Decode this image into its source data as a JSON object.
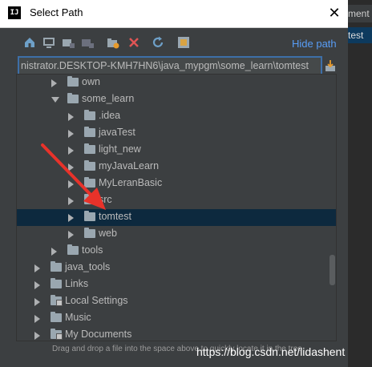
{
  "window": {
    "title": "Select Path",
    "app_icon_text": "IJ",
    "close_glyph": "✕"
  },
  "side_panel": {
    "strip1_text": "ment",
    "strip2_text": "test"
  },
  "toolbar": {
    "icons": [
      "home-icon",
      "desktop-icon",
      "project-icon",
      "module-icon",
      "new-folder-icon",
      "delete-icon",
      "refresh-icon",
      "show-hidden-icon"
    ],
    "hide_path_label": "Hide path"
  },
  "path": {
    "value": "nistrator.DESKTOP-KMH7HN6\\java_mypgm\\some_learn\\tomtest"
  },
  "tree": {
    "rows": [
      {
        "label": "own",
        "expanded": false,
        "indent": 2
      },
      {
        "label": "some_learn",
        "expanded": true,
        "indent": 2
      },
      {
        "label": ".idea",
        "expanded": false,
        "indent": 3
      },
      {
        "label": "javaTest",
        "expanded": false,
        "indent": 3
      },
      {
        "label": "light_new",
        "expanded": false,
        "indent": 3
      },
      {
        "label": "myJavaLearn",
        "expanded": false,
        "indent": 3
      },
      {
        "label": "MyLeranBasic",
        "expanded": false,
        "indent": 3
      },
      {
        "label": "src",
        "expanded": false,
        "indent": 3
      },
      {
        "label": "tomtest",
        "expanded": false,
        "indent": 3,
        "selected": true
      },
      {
        "label": "web",
        "expanded": false,
        "indent": 3
      },
      {
        "label": "tools",
        "expanded": false,
        "indent": 2
      },
      {
        "label": "java_tools",
        "expanded": false,
        "indent": 1
      },
      {
        "label": "Links",
        "expanded": false,
        "indent": 1
      },
      {
        "label": "Local Settings",
        "expanded": false,
        "indent": 1,
        "special": true
      },
      {
        "label": "Music",
        "expanded": false,
        "indent": 1
      },
      {
        "label": "My Documents",
        "expanded": false,
        "indent": 1,
        "special": true
      }
    ]
  },
  "status": {
    "text": "Drag and drop a file into the space above to quickly locate it in the tree"
  },
  "watermark": {
    "text": "https://blog.csdn.net/lidashent"
  },
  "colors": {
    "accent": "#589df6",
    "selection": "#0d293e",
    "annotation_arrow": "#e8322a"
  }
}
